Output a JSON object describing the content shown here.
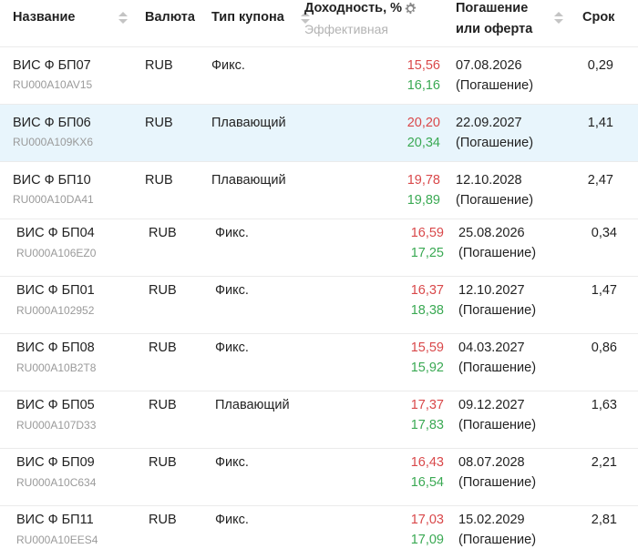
{
  "header": {
    "name": "Название",
    "currency": "Валюта",
    "coupon_type": "Тип купона",
    "yield": "Доходность, %",
    "yield_sub": "Эффективная",
    "maturity_line1": "Погашение",
    "maturity_line2": "или оферта",
    "term": "Срок"
  },
  "rows": [
    {
      "name": "ВИС Ф БП07",
      "isin": "RU000A10AV15",
      "currency": "RUB",
      "coupon": "Фикс.",
      "yield_red": "15,56",
      "yield_green": "16,16",
      "date": "07.08.2026",
      "date_note": "(Погашение)",
      "term": "0,29"
    },
    {
      "name": "ВИС Ф БП06",
      "isin": "RU000A109KX6",
      "currency": "RUB",
      "coupon": "Плавающий",
      "yield_red": "20,20",
      "yield_green": "20,34",
      "date": "22.09.2027",
      "date_note": "(Погашение)",
      "term": "1,41"
    },
    {
      "name": "ВИС Ф БП10",
      "isin": "RU000A10DA41",
      "currency": "RUB",
      "coupon": "Плавающий",
      "yield_red": "19,78",
      "yield_green": "19,89",
      "date": "12.10.2028",
      "date_note": "(Погашение)",
      "term": "2,47"
    },
    {
      "name": "ВИС Ф БП04",
      "isin": "RU000A106EZ0",
      "currency": "RUB",
      "coupon": "Фикс.",
      "yield_red": "16,59",
      "yield_green": "17,25",
      "date": "25.08.2026",
      "date_note": "(Погашение)",
      "term": "0,34"
    },
    {
      "name": "ВИС Ф БП01",
      "isin": "RU000A102952",
      "currency": "RUB",
      "coupon": "Фикс.",
      "yield_red": "16,37",
      "yield_green": "18,38",
      "date": "12.10.2027",
      "date_note": "(Погашение)",
      "term": "1,47"
    },
    {
      "name": "ВИС Ф БП08",
      "isin": "RU000A10B2T8",
      "currency": "RUB",
      "coupon": "Фикс.",
      "yield_red": "15,59",
      "yield_green": "15,92",
      "date": "04.03.2027",
      "date_note": "(Погашение)",
      "term": "0,86"
    },
    {
      "name": "ВИС Ф БП05",
      "isin": "RU000A107D33",
      "currency": "RUB",
      "coupon": "Плавающий",
      "yield_red": "17,37",
      "yield_green": "17,83",
      "date": "09.12.2027",
      "date_note": "(Погашение)",
      "term": "1,63"
    },
    {
      "name": "ВИС Ф БП09",
      "isin": "RU000A10C634",
      "currency": "RUB",
      "coupon": "Фикс.",
      "yield_red": "16,43",
      "yield_green": "16,54",
      "date": "08.07.2028",
      "date_note": "(Погашение)",
      "term": "2,21"
    },
    {
      "name": "ВИС Ф БП11",
      "isin": "RU000A10EES4",
      "currency": "RUB",
      "coupon": "Фикс.",
      "yield_red": "17,03",
      "yield_green": "17,09",
      "date": "15.02.2029",
      "date_note": "(Погашение)",
      "term": "2,81"
    }
  ],
  "colors": {
    "yield_red": "#d9484a",
    "yield_green": "#3aa953",
    "highlight_row": "#e8f5fc"
  },
  "icons": {
    "sort": "sort-arrows-icon",
    "settings": "gear-icon"
  }
}
